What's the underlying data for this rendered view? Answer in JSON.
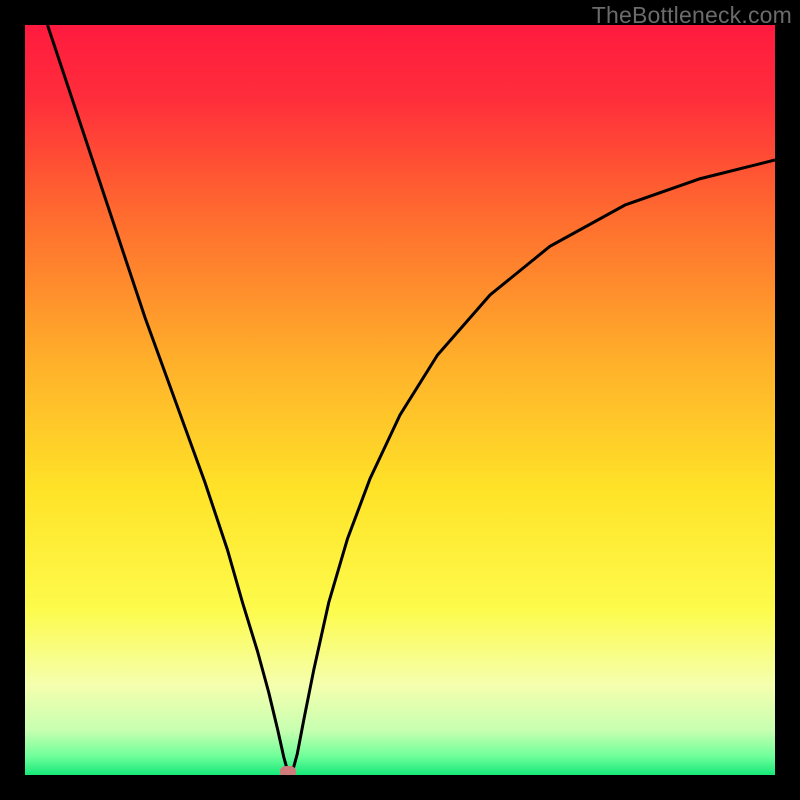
{
  "watermark": "TheBottleneck.com",
  "chart_data": {
    "type": "line",
    "title": "",
    "xlabel": "",
    "ylabel": "",
    "xlim": [
      0,
      100
    ],
    "ylim": [
      0,
      100
    ],
    "grid": false,
    "legend": false,
    "background_gradient": {
      "stops": [
        {
          "pos": 0.0,
          "color": "#ff1a3f"
        },
        {
          "pos": 0.1,
          "color": "#ff2e3b"
        },
        {
          "pos": 0.25,
          "color": "#ff6a2f"
        },
        {
          "pos": 0.45,
          "color": "#ffb02a"
        },
        {
          "pos": 0.62,
          "color": "#ffe328"
        },
        {
          "pos": 0.78,
          "color": "#fdfb4c"
        },
        {
          "pos": 0.88,
          "color": "#f5ffae"
        },
        {
          "pos": 0.94,
          "color": "#c8ffb0"
        },
        {
          "pos": 0.975,
          "color": "#6fff9a"
        },
        {
          "pos": 1.0,
          "color": "#17e87a"
        }
      ]
    },
    "series": [
      {
        "name": "bottleneck-curve",
        "x": [
          3,
          5,
          8,
          12,
          16,
          20,
          24,
          27,
          29,
          31,
          32.5,
          33.7,
          34.5,
          35.0,
          35.3,
          35.7,
          36.3,
          37.2,
          38.5,
          40.5,
          43,
          46,
          50,
          55,
          62,
          70,
          80,
          90,
          100
        ],
        "y": [
          100,
          94,
          85,
          73,
          61,
          50,
          39,
          30,
          23,
          16.5,
          11,
          6,
          2.4,
          0.6,
          0.1,
          0.6,
          2.8,
          7.5,
          14,
          23,
          31.5,
          39.5,
          48,
          56,
          64,
          70.5,
          76,
          79.5,
          82
        ],
        "color": "#000000"
      }
    ],
    "marker": {
      "x": 35.1,
      "y": 0.4,
      "color": "#cf7b7b"
    }
  }
}
